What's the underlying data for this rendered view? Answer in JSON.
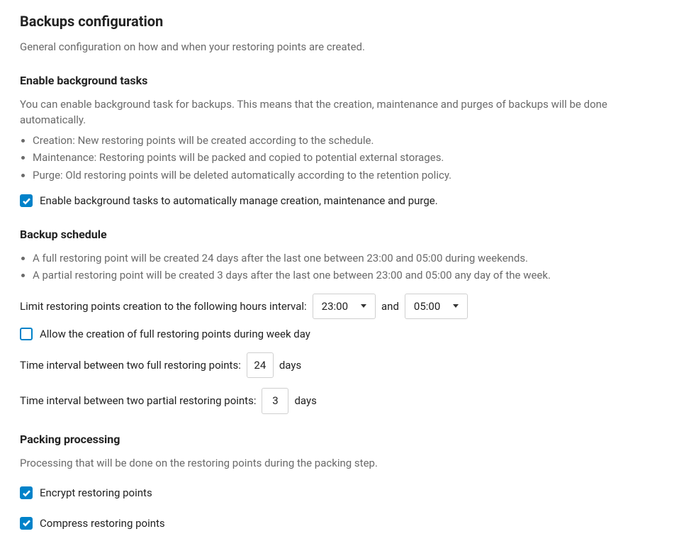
{
  "page": {
    "title": "Backups configuration",
    "subtitle": "General configuration on how and when your restoring points are created."
  },
  "enable_bg": {
    "heading": "Enable background tasks",
    "intro": "You can enable background task for backups. This means that the creation, maintenance and purges of backups will be done automatically.",
    "bullets": {
      "0": "Creation: New restoring points will be created according to the schedule.",
      "1": "Maintenance: Restoring points will be packed and copied to potential external storages.",
      "2": "Purge: Old restoring points will be deleted automatically according to the retention policy."
    },
    "checkbox_label": "Enable background tasks to automatically manage creation, maintenance and purge."
  },
  "schedule": {
    "heading": "Backup schedule",
    "bullets": {
      "0": "A full restoring point will be created 24 days after the last one between 23:00 and 05:00 during weekends.",
      "1": "A partial restoring point will be created 3 days after the last one between 23:00 and 05:00 any day of the week."
    },
    "limit_label": "Limit restoring points creation to the following hours interval:",
    "time_start": "23:00",
    "and_label": "and",
    "time_end": "05:00",
    "allow_weekday_label": "Allow the creation of full restoring points during week day",
    "full_interval_label": "Time interval between two full restoring points:",
    "full_interval_value": "24",
    "full_interval_unit": "days",
    "partial_interval_label": "Time interval between two partial restoring points:",
    "partial_interval_value": "3",
    "partial_interval_unit": "days"
  },
  "packing": {
    "heading": "Packing processing",
    "desc": "Processing that will be done on the restoring points during the packing step.",
    "encrypt_label": "Encrypt restoring points",
    "compress_label": "Compress restoring points"
  }
}
